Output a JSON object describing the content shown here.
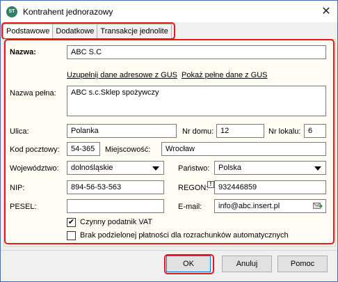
{
  "window": {
    "title": "Kontrahent jednorazowy",
    "icon_text": "ST"
  },
  "tabs": [
    {
      "label": "Podstawowe"
    },
    {
      "label": "Dodatkowe"
    },
    {
      "label": "Transakcje jednolite"
    }
  ],
  "form": {
    "nazwa_label": "Nazwa:",
    "nazwa_value": "ABC S.C",
    "link_uzupelnij": "Uzupełnij dane adresowe z GUS",
    "link_pokaz": "Pokaż pełne dane z GUS",
    "nazwa_pelna_label": "Nazwa pełna:",
    "nazwa_pelna_value": "ABC s.c.Sklep spożywczy",
    "ulica_label": "Ulica:",
    "ulica_value": "Polanka",
    "nr_domu_label": "Nr domu:",
    "nr_domu_value": "12",
    "nr_lokalu_label": "Nr lokalu:",
    "nr_lokalu_value": "6",
    "kod_label": "Kod pocztowy:",
    "kod_value": "54-365",
    "miejscowosc_label": "Miejscowość:",
    "miejscowosc_value": "Wrocław",
    "wojewodztwo_label": "Województwo:",
    "wojewodztwo_value": "dolnośląskie",
    "panstwo_label": "Państwo:",
    "panstwo_value": "Polska",
    "nip_label": "NIP:",
    "nip_value": "894-56-53-563",
    "regon_label": "REGON:",
    "regon_value": "932446859",
    "pesel_label": "PESEL:",
    "pesel_value": "",
    "email_label": "E-mail:",
    "email_value": "info@abc.insert.pl",
    "vat_label": "Czynny podatnik VAT",
    "vat_checked": true,
    "split_label": "Brak podzielonej płatności dla rozrachunków automatycznych",
    "split_checked": false
  },
  "buttons": {
    "ok": "OK",
    "cancel": "Anuluj",
    "help": "Pomoc"
  },
  "colors": {
    "highlight": "#e8141e",
    "panel_bg": "#fffcf3",
    "window_border": "#3c6db5"
  }
}
